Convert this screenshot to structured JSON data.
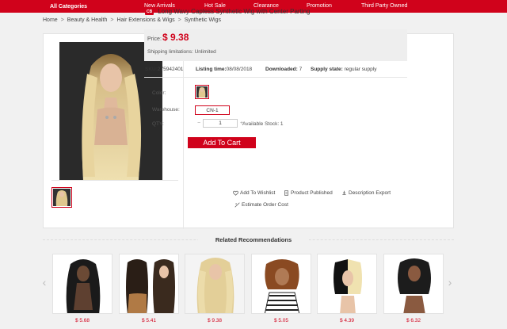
{
  "nav": {
    "all_categories": "All Categories",
    "items": [
      "New Arrivals",
      "Hot Sale",
      "Clearance",
      "Promotion",
      "Third Party Owned"
    ]
  },
  "breadcrumb": [
    "Home",
    "Beauty & Health",
    "Hair Extensions & Wigs",
    "Synthetic Wigs"
  ],
  "product": {
    "badge": "CB",
    "title": "Long Wavy Capless Synthetic Wig with Center Parting",
    "price_label": "Price:",
    "price": "$ 9.38",
    "shipping": "Shipping limitations: Unlimited",
    "sku_label": "SKU:",
    "sku": "275942401",
    "listing_label": "Listing time:",
    "listing": "08/08/2018",
    "downloaded_label": "Downloaded:",
    "downloaded": "7",
    "supply_label": "Supply state:",
    "supply": "regular supply",
    "color_label": "Color:",
    "warehouse_label": "Warehouse:",
    "warehouse": "CN-1",
    "qty_label": "QTY:",
    "qty": "1",
    "stock": "Available Stock: 1",
    "add_to_cart": "Add To Cart",
    "wishlist": "Add To Wishlist",
    "published": "Product Published",
    "export": "Description Export",
    "estimate": "Estimate Order Cost"
  },
  "related": {
    "title": "Related Recommendations",
    "items": [
      {
        "price": "$ 5.68"
      },
      {
        "price": "$ 5.41"
      },
      {
        "price": "$ 9.38"
      },
      {
        "price": "$ 5.05"
      },
      {
        "price": "$ 4.39"
      },
      {
        "price": "$ 6.32"
      }
    ]
  },
  "colors": {
    "brand": "#d0021b"
  }
}
